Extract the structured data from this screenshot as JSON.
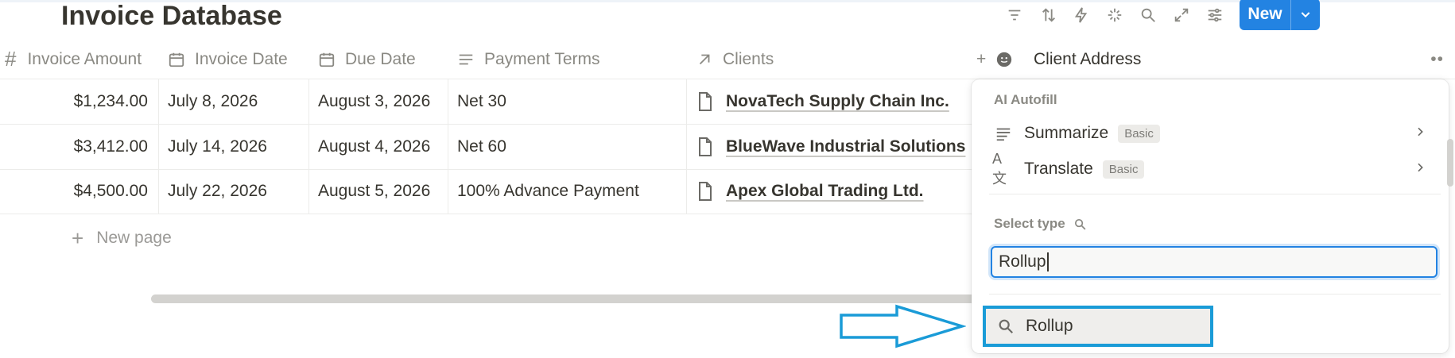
{
  "page": {
    "title": "Invoice Database"
  },
  "toolbar": {
    "icons": [
      "filter-icon",
      "sort-icon",
      "automation-icon",
      "ai-sparkle-icon",
      "search-icon",
      "expand-icon",
      "settings-icon"
    ],
    "new_label": "New",
    "accent": "#2383e2"
  },
  "table": {
    "columns": [
      {
        "label": "Invoice Amount",
        "icon": "number-icon"
      },
      {
        "label": "Invoice Date",
        "icon": "calendar-icon"
      },
      {
        "label": "Due Date",
        "icon": "calendar-icon"
      },
      {
        "label": "Payment Terms",
        "icon": "text-icon"
      },
      {
        "label": "Clients",
        "icon": "relation-arrow-icon"
      },
      {
        "label": "Client Address",
        "icon": "person-icon"
      }
    ],
    "rows": [
      {
        "amount": "$1,234.00",
        "invoice_date": "July 8, 2026",
        "due_date": "August 3, 2026",
        "terms": "Net 30",
        "client": "NovaTech Supply Chain Inc."
      },
      {
        "amount": "$3,412.00",
        "invoice_date": "July 14, 2026",
        "due_date": "August 4, 2026",
        "terms": "Net 60",
        "client": "BlueWave Industrial Solutions"
      },
      {
        "amount": "$4,500.00",
        "invoice_date": "July 22, 2026",
        "due_date": "August 5, 2026",
        "terms": "100% Advance Payment",
        "client": "Apex Global Trading Ltd."
      }
    ],
    "new_page_label": "New page"
  },
  "property_menu": {
    "ai_section": "AI Autofill",
    "ai_items": [
      {
        "label": "Summarize",
        "badge": "Basic"
      },
      {
        "label": "Translate",
        "badge": "Basic"
      }
    ],
    "select_type_label": "Select type",
    "search_value": "Rollup",
    "result_label": "Rollup",
    "highlight_color": "#1a9bd7"
  }
}
